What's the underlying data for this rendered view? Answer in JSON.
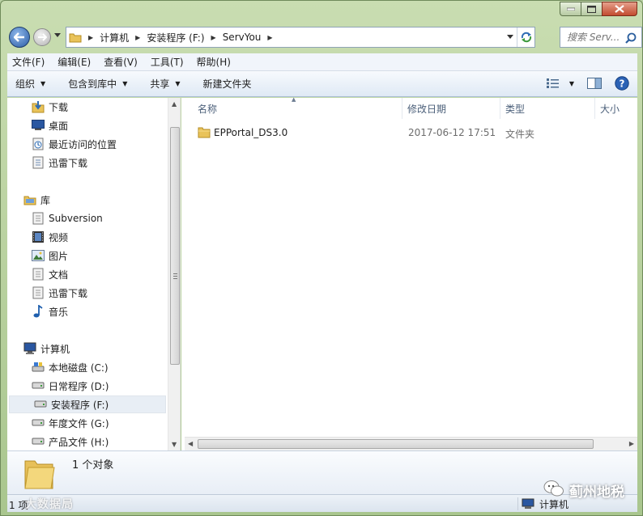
{
  "window": {
    "minimize_icon": "minimize-icon",
    "maximize_icon": "maximize-icon",
    "close_icon": "close-icon"
  },
  "address_bar": {
    "segments": [
      "计算机",
      "安装程序 (F:)",
      "ServYou"
    ]
  },
  "search": {
    "placeholder": "搜索 Serv..."
  },
  "menu": {
    "items": [
      "文件(F)",
      "编辑(E)",
      "查看(V)",
      "工具(T)",
      "帮助(H)"
    ]
  },
  "toolbar": {
    "organize": "组织",
    "include_in_library": "包含到库中",
    "share": "共享",
    "new_folder": "新建文件夹"
  },
  "nav_pane": {
    "favorites": [
      "下载",
      "桌面",
      "最近访问的位置",
      "迅雷下载"
    ],
    "library_header": "库",
    "libraries": [
      "Subversion",
      "视频",
      "图片",
      "文档",
      "迅雷下载",
      "音乐"
    ],
    "computer_header": "计算机",
    "drives": [
      "本地磁盘 (C:)",
      "日常程序 (D:)",
      "安装程序 (F:)",
      "年度文件 (G:)",
      "产品文件 (H:)"
    ],
    "selected_drive": "安装程序 (F:)"
  },
  "columns": {
    "name": "名称",
    "modified": "修改日期",
    "type": "类型",
    "size": "大小"
  },
  "files": [
    {
      "name": "EPPortal_DS3.0",
      "modified": "2017-06-12 17:51",
      "type": "文件夹",
      "size": ""
    }
  ],
  "details": {
    "summary": "1 个对象"
  },
  "status": {
    "left_count": "1 项",
    "right_label": "计算机"
  },
  "watermark": {
    "left": "大数据局",
    "right": "蓟州地税"
  },
  "colors": {
    "frame": "#b9d1a3",
    "selection": "#e8eef5",
    "header_text": "#4c607a",
    "muted_text": "#6d6d6d"
  }
}
